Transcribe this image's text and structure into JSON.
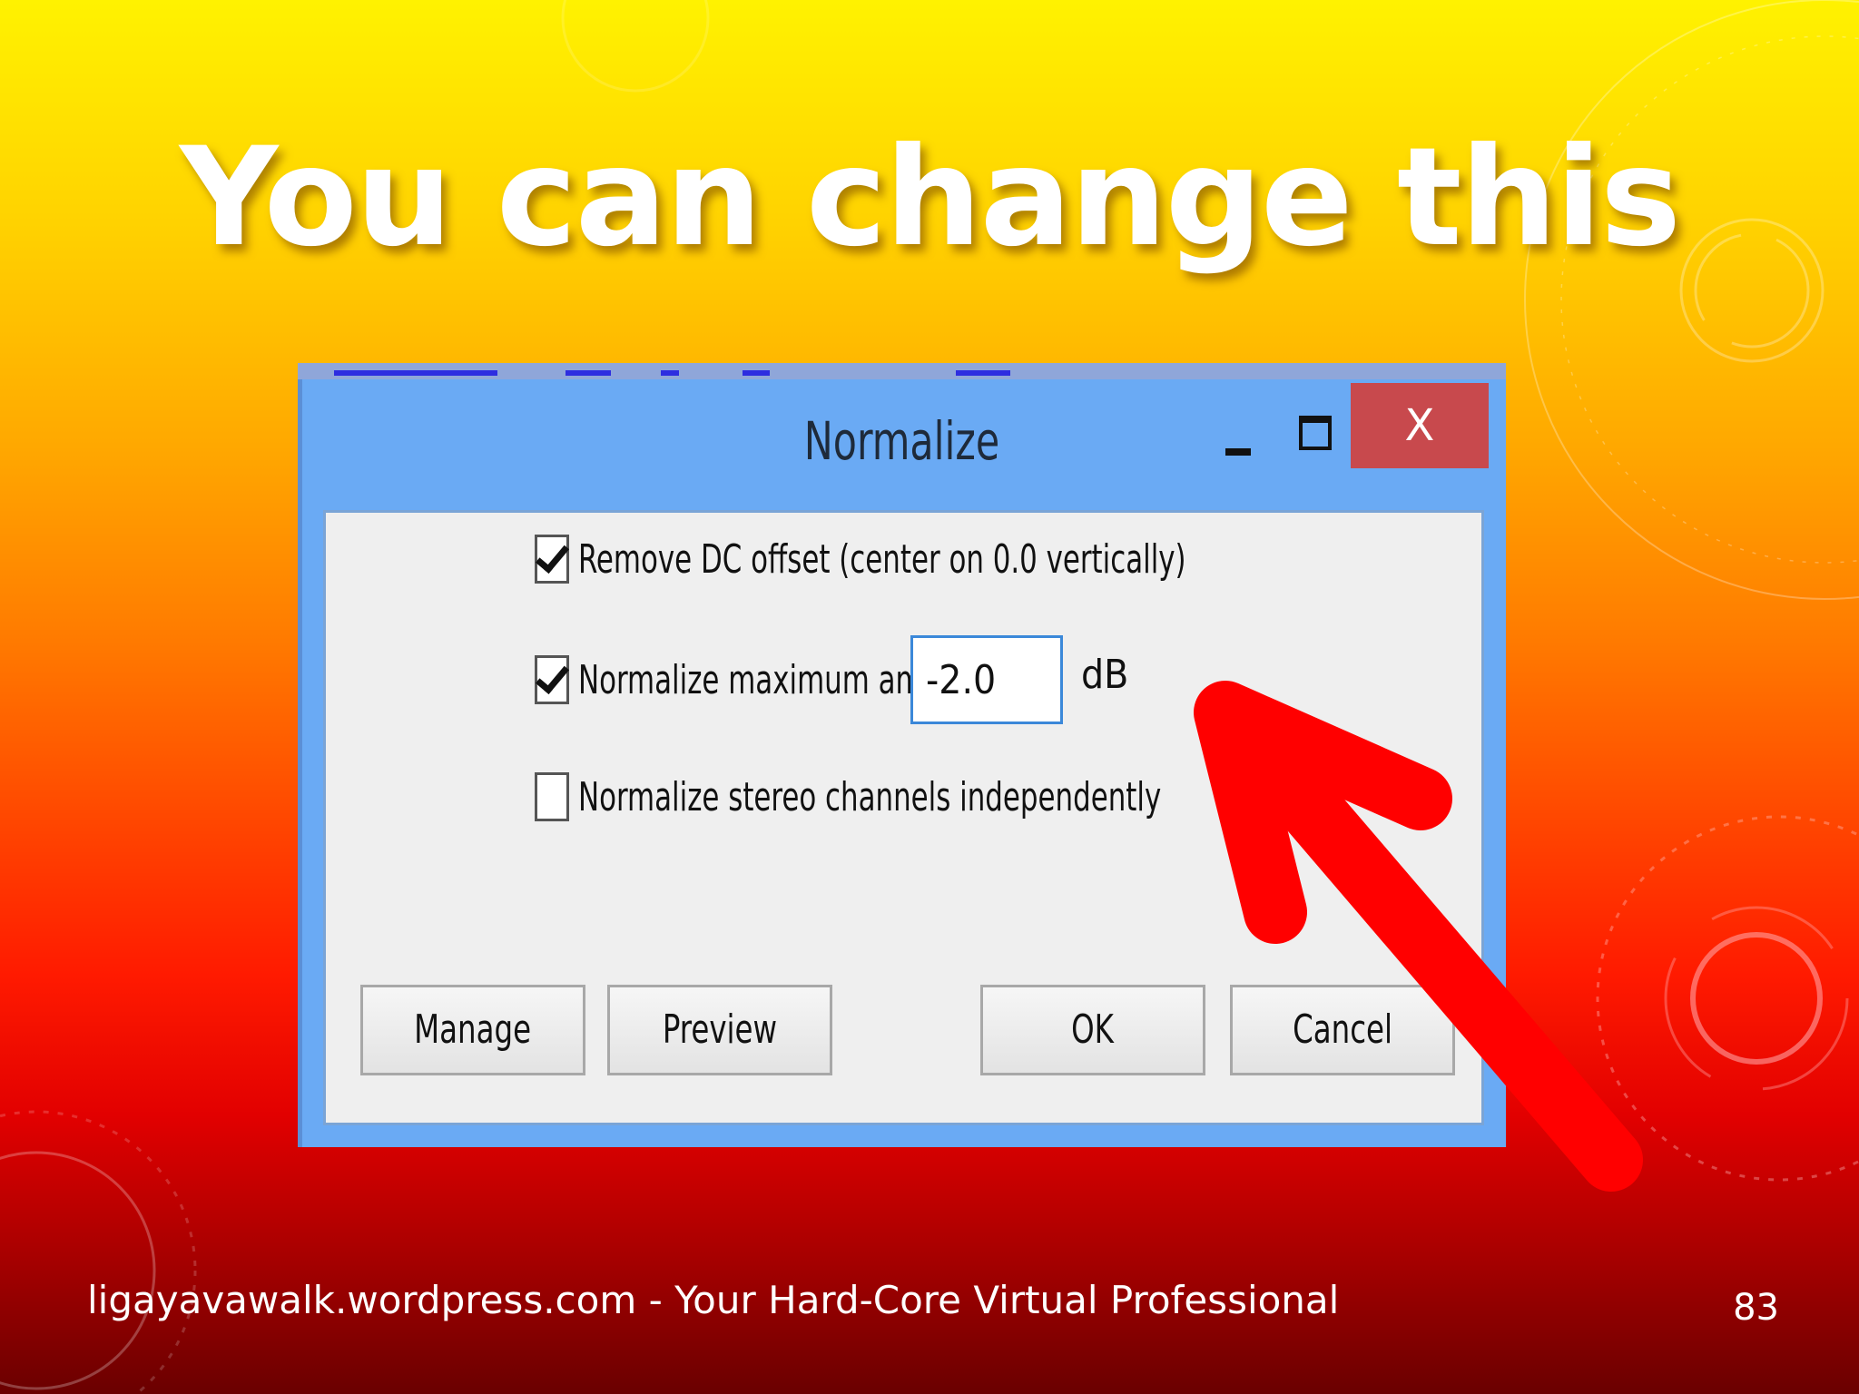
{
  "slide": {
    "title": "You can change this",
    "footer": "ligayavawalk.wordpress.com - Your Hard-Core Virtual Professional",
    "page_number": "83"
  },
  "dialog": {
    "title": "Normalize",
    "close_glyph": "X",
    "options": {
      "remove_dc": {
        "label": "Remove DC offset (center on 0.0 vertically)",
        "checked": true
      },
      "normalize_amp": {
        "label": "Normalize maximum amplitude to",
        "checked": true,
        "value": "-2.0",
        "unit": "dB"
      },
      "stereo_indep": {
        "label": "Normalize stereo channels independently",
        "checked": false
      }
    },
    "buttons": {
      "manage": "Manage",
      "preview": "Preview",
      "ok": "OK",
      "cancel": "Cancel"
    }
  },
  "annotation": {
    "arrow_color": "#ff0000",
    "icon": "red-arrow-icon"
  }
}
